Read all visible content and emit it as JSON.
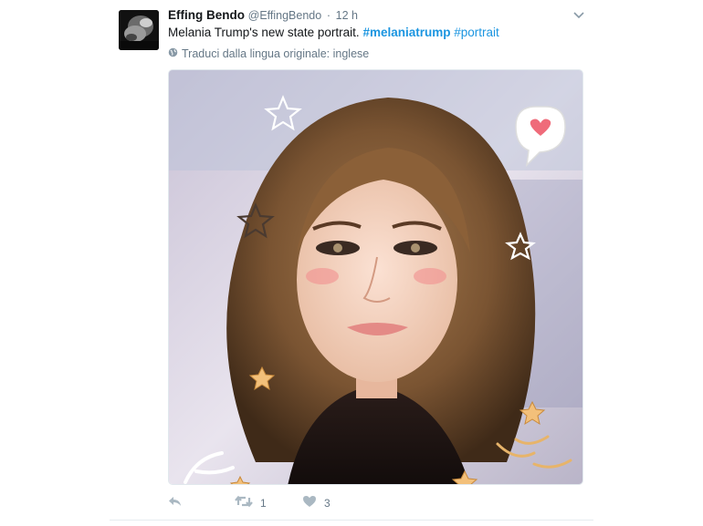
{
  "tweet": {
    "display_name": "Effing Bendo",
    "handle": "@EffingBendo",
    "separator": "·",
    "time": "12 h",
    "text_plain": "Melania Trump's new state portrait.",
    "hashtag_1": "#melaniatrump",
    "hashtag_2": "#portrait",
    "translate_label": "Traduci dalla lingua originale: inglese"
  },
  "actions": {
    "retweet_count": "1",
    "like_count": "3"
  },
  "colors": {
    "link": "#1b95e0",
    "secondary_text": "#657786",
    "action_icon": "#aab8c2",
    "primary_text": "#14171a"
  },
  "icons": {
    "caret": "chevron-down-icon",
    "globe": "globe-icon",
    "reply": "reply-icon",
    "retweet": "retweet-icon",
    "like": "heart-icon"
  }
}
